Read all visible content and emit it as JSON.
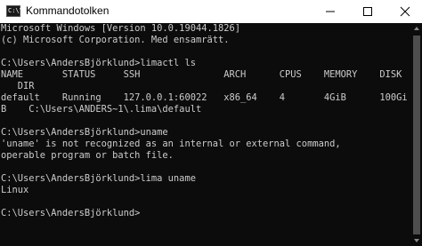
{
  "window": {
    "title": "Kommandotolken",
    "icon_label": "C:\\\\",
    "controls": {
      "minimize_icon": "minimize-icon",
      "maximize_icon": "maximize-icon",
      "close_icon": "close-icon"
    }
  },
  "terminal": {
    "lines": [
      "Microsoft Windows [Version 10.0.19044.1826]",
      "(c) Microsoft Corporation. Med ensamrätt.",
      "",
      "C:\\Users\\AndersBjörklund>limactl ls",
      "NAME       STATUS     SSH               ARCH      CPUS    MEMORY    DISK",
      "   DIR",
      "default    Running    127.0.0.1:60022   x86_64    4       4GiB      100Gi",
      "B    C:\\Users\\ANDERS~1\\.lima\\default",
      "",
      "C:\\Users\\AndersBjörklund>uname",
      "'uname' is not recognized as an internal or external command,",
      "operable program or batch file.",
      "",
      "C:\\Users\\AndersBjörklund>lima uname",
      "Linux",
      "",
      "C:\\Users\\AndersBjörklund>"
    ]
  },
  "colors": {
    "titlebar": "#ffffff",
    "terminal_bg": "#0c0c0c",
    "terminal_fg": "#cccccc",
    "scrollbar_thumb": "#4d4d4d"
  }
}
